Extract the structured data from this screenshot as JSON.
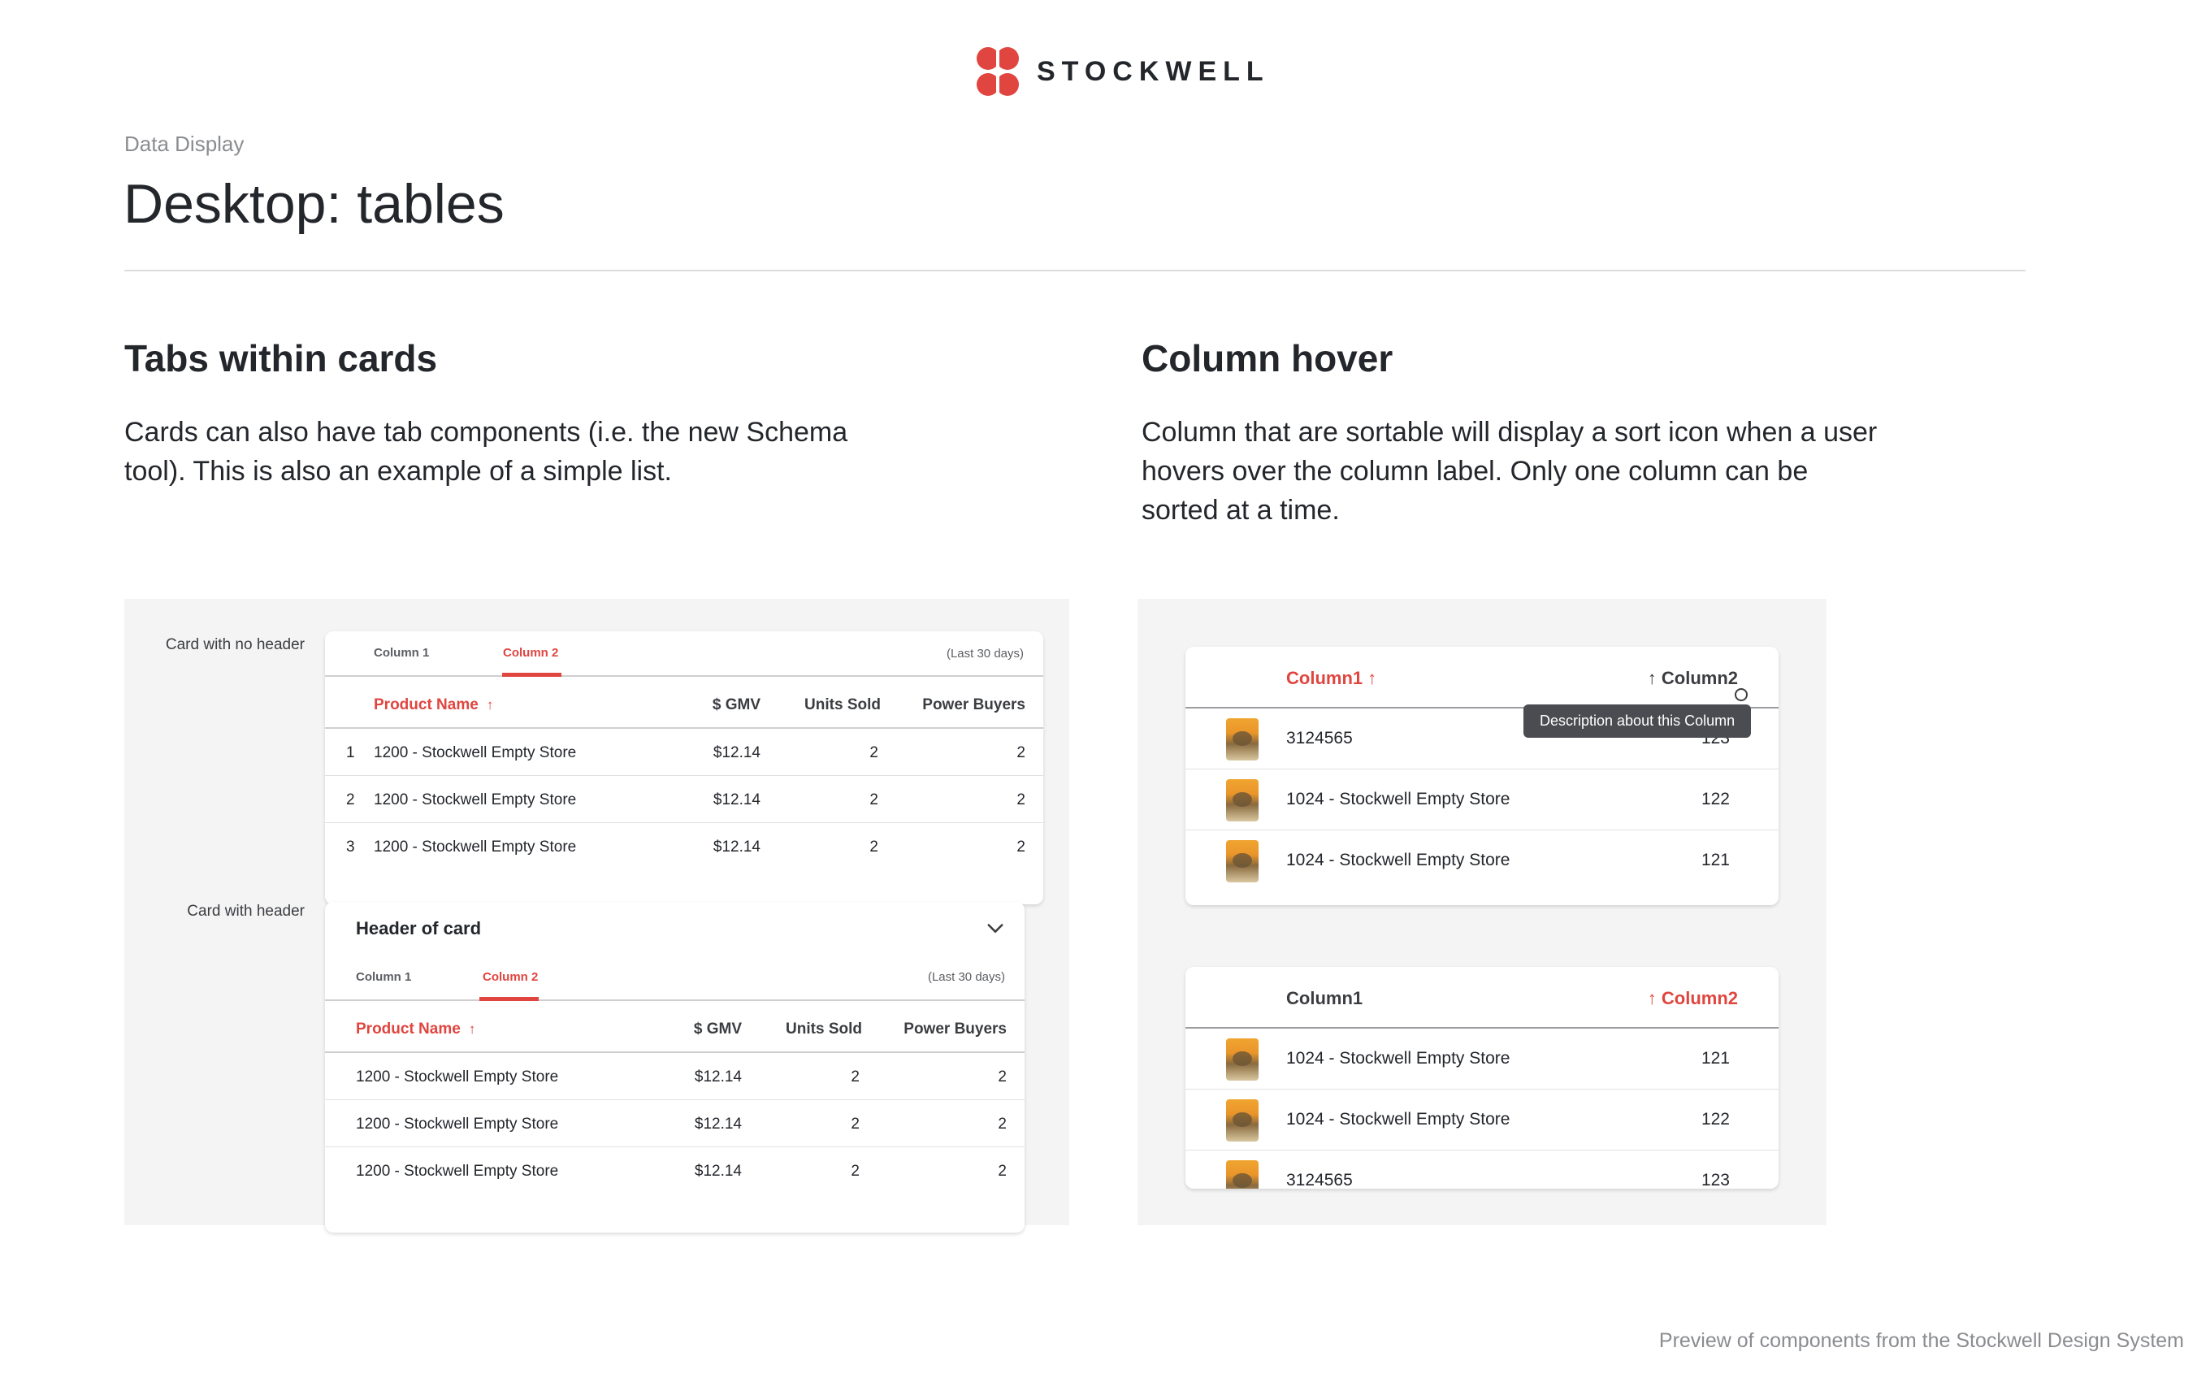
{
  "brand": {
    "name": "STOCKWELL",
    "accent": "#e0453f"
  },
  "eyebrow": "Data Display",
  "title": "Desktop: tables",
  "sections": {
    "tabs": {
      "title": "Tabs within cards",
      "description": "Cards can also have tab components (i.e. the new Schema tool). This is also an example of a simple list."
    },
    "hover": {
      "title": "Column hover",
      "description": "Column that are sortable will display a sort icon when a user hovers over the column label. Only one column can be sorted at a time."
    }
  },
  "card_no_header": {
    "label": "Card with no header",
    "tabs": [
      "Column 1",
      "Column 2"
    ],
    "active_tab": 1,
    "meta": "(Last 30 days)",
    "columns": [
      "Product Name",
      "$ GMV",
      "Units Sold",
      "Power Buyers"
    ],
    "sorted_column": 0,
    "sort_icon": "arrow-up-icon",
    "rows": [
      {
        "index": "1",
        "name": "1200 - Stockwell Empty Store",
        "gmv": "$12.14",
        "units": "2",
        "buyers": "2"
      },
      {
        "index": "2",
        "name": "1200 - Stockwell Empty Store",
        "gmv": "$12.14",
        "units": "2",
        "buyers": "2"
      },
      {
        "index": "3",
        "name": "1200 - Stockwell Empty Store",
        "gmv": "$12.14",
        "units": "2",
        "buyers": "2"
      }
    ]
  },
  "card_with_header": {
    "label": "Card with header",
    "header": "Header of card",
    "header_icon": "chevron-down-icon",
    "tabs": [
      "Column 1",
      "Column 2"
    ],
    "active_tab": 1,
    "meta": "(Last 30 days)",
    "columns": [
      "Product Name",
      "$ GMV",
      "Units Sold",
      "Power Buyers"
    ],
    "sorted_column": 0,
    "rows": [
      {
        "name": "1200 - Stockwell Empty Store",
        "gmv": "$12.14",
        "units": "2",
        "buyers": "2"
      },
      {
        "name": "1200 - Stockwell Empty Store",
        "gmv": "$12.14",
        "units": "2",
        "buyers": "2"
      },
      {
        "name": "1200 - Stockwell Empty Store",
        "gmv": "$12.14",
        "units": "2",
        "buyers": "2"
      }
    ]
  },
  "hover_table_1": {
    "columns": [
      "Column1",
      "Column2"
    ],
    "sorted_column": 0,
    "hovered_column": 1,
    "tooltip": "Description about this Column",
    "rows": [
      {
        "name": "3124565",
        "value": "123"
      },
      {
        "name": "1024 - Stockwell Empty Store",
        "value": "122"
      },
      {
        "name": "1024 - Stockwell Empty Store",
        "value": "121"
      }
    ]
  },
  "hover_table_2": {
    "columns": [
      "Column1",
      "Column2"
    ],
    "sorted_column": 1,
    "rows": [
      {
        "name": "1024 - Stockwell Empty Store",
        "value": "121"
      },
      {
        "name": "1024 - Stockwell Empty Store",
        "value": "122"
      },
      {
        "name": "3124565",
        "value": "123"
      }
    ]
  },
  "footer": "Preview of components from the Stockwell Design System"
}
